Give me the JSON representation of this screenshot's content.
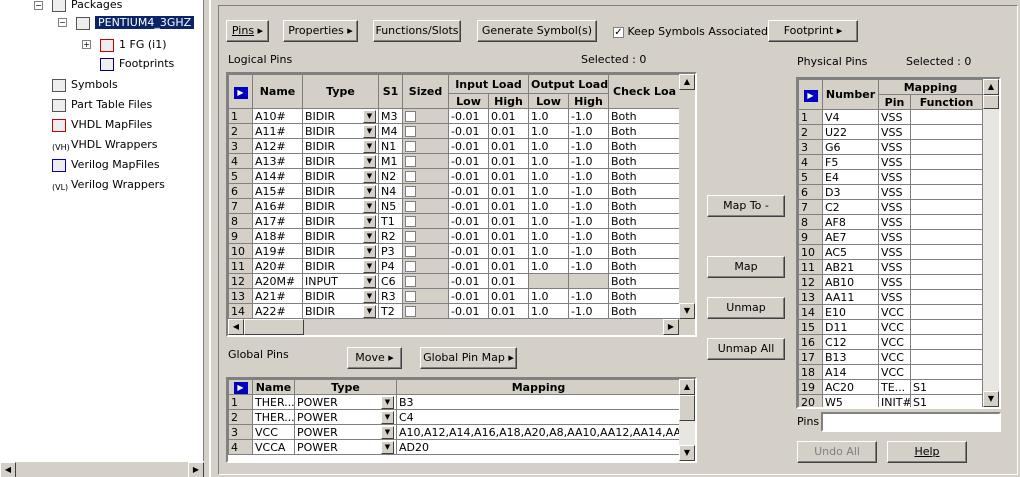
{
  "tree": {
    "items": [
      {
        "label": "Packages",
        "icon": "packages-icon"
      },
      {
        "label": "PENTIUM4_3GHZ",
        "icon": "chip-icon"
      },
      {
        "label": "1 FG (i1)",
        "icon": "function-icon"
      },
      {
        "label": "Footprints",
        "icon": "footprint-icon"
      },
      {
        "label": "Symbols",
        "icon": "symbol-icon"
      },
      {
        "label": "Part Table Files",
        "icon": "table-icon"
      },
      {
        "label": "VHDL MapFiles",
        "icon": "vhdl-icon"
      },
      {
        "label": "VHDL Wrappers",
        "icon": "vhdl-wrapper-icon"
      },
      {
        "label": "Verilog MapFiles",
        "icon": "verilog-icon"
      },
      {
        "label": "Verilog Wrappers",
        "icon": "verilog-wrapper-icon"
      }
    ]
  },
  "toolbar": {
    "pins": "Pins",
    "properties": "Properties",
    "functions": "Functions/Slots",
    "generate": "Generate Symbol(s)",
    "keep_assoc": "Keep Symbols Associated",
    "footprint": "Footprint"
  },
  "logical": {
    "title": "Logical Pins",
    "selected": "Selected :  0",
    "headers": {
      "name": "Name",
      "type": "Type",
      "s1": "S1",
      "sized": "Sized",
      "input_load": "Input Load",
      "output_load": "Output Load",
      "check_load": "Check Loa",
      "low": "Low",
      "high": "High"
    },
    "rows": [
      [
        "1",
        "A10#",
        "BIDIR",
        "M3",
        "-0.01",
        "0.01",
        "1.0",
        "-1.0",
        "Both"
      ],
      [
        "2",
        "A11#",
        "BIDIR",
        "M4",
        "-0.01",
        "0.01",
        "1.0",
        "-1.0",
        "Both"
      ],
      [
        "3",
        "A12#",
        "BIDIR",
        "N1",
        "-0.01",
        "0.01",
        "1.0",
        "-1.0",
        "Both"
      ],
      [
        "4",
        "A13#",
        "BIDIR",
        "M1",
        "-0.01",
        "0.01",
        "1.0",
        "-1.0",
        "Both"
      ],
      [
        "5",
        "A14#",
        "BIDIR",
        "N2",
        "-0.01",
        "0.01",
        "1.0",
        "-1.0",
        "Both"
      ],
      [
        "6",
        "A15#",
        "BIDIR",
        "N4",
        "-0.01",
        "0.01",
        "1.0",
        "-1.0",
        "Both"
      ],
      [
        "7",
        "A16#",
        "BIDIR",
        "N5",
        "-0.01",
        "0.01",
        "1.0",
        "-1.0",
        "Both"
      ],
      [
        "8",
        "A17#",
        "BIDIR",
        "T1",
        "-0.01",
        "0.01",
        "1.0",
        "-1.0",
        "Both"
      ],
      [
        "9",
        "A18#",
        "BIDIR",
        "R2",
        "-0.01",
        "0.01",
        "1.0",
        "-1.0",
        "Both"
      ],
      [
        "10",
        "A19#",
        "BIDIR",
        "P3",
        "-0.01",
        "0.01",
        "1.0",
        "-1.0",
        "Both"
      ],
      [
        "11",
        "A20#",
        "BIDIR",
        "P4",
        "-0.01",
        "0.01",
        "1.0",
        "-1.0",
        "Both"
      ],
      [
        "12",
        "A20M#",
        "INPUT",
        "C6",
        "-0.01",
        "0.01",
        "",
        "",
        "Both"
      ],
      [
        "13",
        "A21#",
        "BIDIR",
        "R3",
        "-0.01",
        "0.01",
        "1.0",
        "-1.0",
        "Both"
      ],
      [
        "14",
        "A22#",
        "BIDIR",
        "T2",
        "-0.01",
        "0.01",
        "1.0",
        "-1.0",
        "Both"
      ]
    ]
  },
  "mid_buttons": {
    "map_to": "Map To -",
    "map": "Map",
    "unmap": "Unmap",
    "unmap_all": "Unmap All"
  },
  "global": {
    "title": "Global Pins",
    "move": "Move",
    "pin_map": "Global Pin Map",
    "headers": {
      "name": "Name",
      "type": "Type",
      "mapping": "Mapping"
    },
    "rows": [
      [
        "1",
        "THER...",
        "POWER",
        "B3"
      ],
      [
        "2",
        "THER...",
        "POWER",
        "C4"
      ],
      [
        "3",
        "VCC",
        "POWER",
        "A10,A12,A14,A16,A18,A20,A8,AA10,AA12,AA14,AA..."
      ],
      [
        "4",
        "VCCA",
        "POWER",
        "AD20"
      ]
    ]
  },
  "physical": {
    "title": "Physical Pins",
    "selected": "Selected :  0",
    "headers": {
      "number": "Number",
      "mapping": "Mapping",
      "pin": "Pin",
      "function": "Function"
    },
    "rows": [
      [
        "1",
        "V4",
        "VSS",
        ""
      ],
      [
        "2",
        "U22",
        "VSS",
        ""
      ],
      [
        "3",
        "G6",
        "VSS",
        ""
      ],
      [
        "4",
        "F5",
        "VSS",
        ""
      ],
      [
        "5",
        "E4",
        "VSS",
        ""
      ],
      [
        "6",
        "D3",
        "VSS",
        ""
      ],
      [
        "7",
        "C2",
        "VSS",
        ""
      ],
      [
        "8",
        "AF8",
        "VSS",
        ""
      ],
      [
        "9",
        "AE7",
        "VSS",
        ""
      ],
      [
        "10",
        "AC5",
        "VSS",
        ""
      ],
      [
        "11",
        "AB21",
        "VSS",
        ""
      ],
      [
        "12",
        "AB10",
        "VSS",
        ""
      ],
      [
        "13",
        "AA11",
        "VSS",
        ""
      ],
      [
        "14",
        "E10",
        "VCC",
        ""
      ],
      [
        "15",
        "D11",
        "VCC",
        ""
      ],
      [
        "16",
        "C12",
        "VCC",
        ""
      ],
      [
        "17",
        "B13",
        "VCC",
        ""
      ],
      [
        "18",
        "A14",
        "VCC",
        ""
      ],
      [
        "19",
        "AC20",
        "TE...",
        "S1"
      ],
      [
        "20",
        "W5",
        "INIT#",
        "S1"
      ]
    ],
    "pins_label": "Pins",
    "undo_all": "Undo All",
    "help": "Help"
  }
}
